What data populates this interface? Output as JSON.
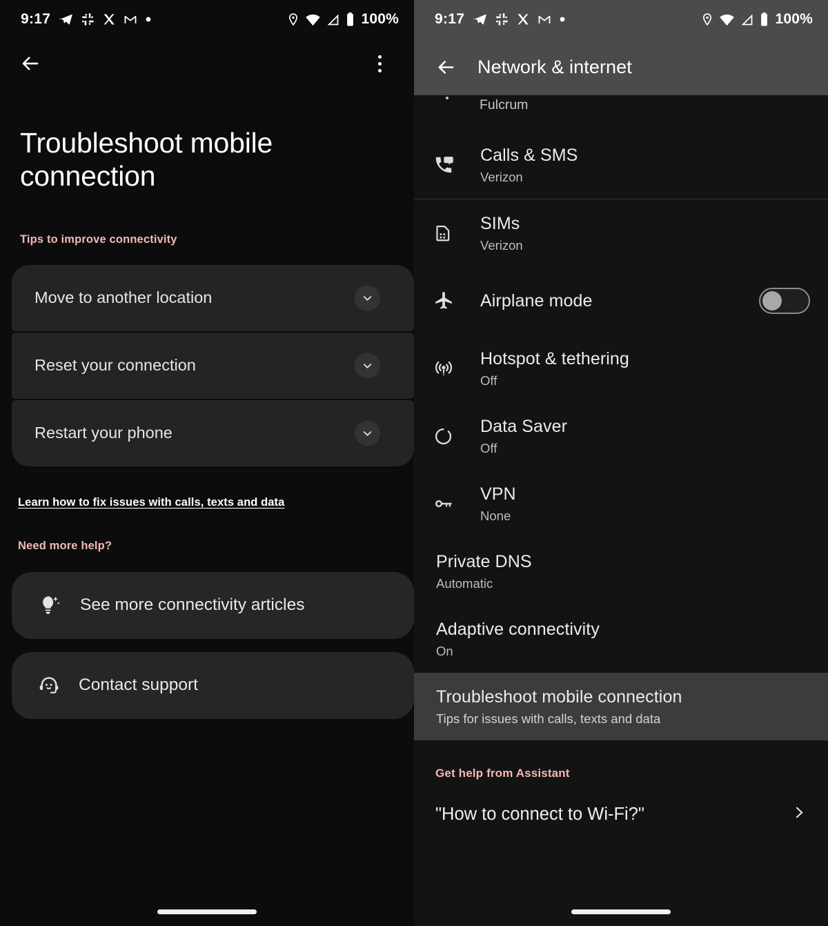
{
  "status_bar": {
    "time": "9:17",
    "battery_text": "100%",
    "notification_icons": [
      "telegram-icon",
      "slack-icon",
      "x-twitter-icon",
      "gmail-icon",
      "dot-icon"
    ],
    "system_icons": [
      "location-icon",
      "wifi-icon",
      "mobile-signal-icon",
      "battery-icon"
    ]
  },
  "left_panel": {
    "appbar": {
      "back_icon": "back-arrow-icon",
      "overflow_icon": "more-vert-icon"
    },
    "title": "Troubleshoot mobile connection",
    "tips_section_label": "Tips to improve connectivity",
    "expanders": [
      {
        "label": "Move to another location",
        "icon": "chevron-down-icon"
      },
      {
        "label": "Reset your connection",
        "icon": "chevron-down-icon"
      },
      {
        "label": "Restart your phone",
        "icon": "chevron-down-icon"
      }
    ],
    "learn_link": "Learn how to fix issues with calls, texts and data",
    "help_section_label": "Need more help?",
    "help_actions": [
      {
        "label": "See more connectivity articles",
        "icon": "lightbulb-sparkle-icon"
      },
      {
        "label": "Contact support",
        "icon": "support-agent-icon"
      }
    ]
  },
  "right_panel": {
    "appbar": {
      "back_icon": "back-arrow-icon",
      "title": "Network & internet"
    },
    "cut_off_row": {
      "subtitle": "Fulcrum"
    },
    "items": [
      {
        "label": "Calls & SMS",
        "sub": "Verizon",
        "icon": "phone-message-icon",
        "has_toggle": false
      },
      {
        "label": "SIMs",
        "sub": "Verizon",
        "icon": "sim-card-icon",
        "has_toggle": false
      },
      {
        "label": "Airplane mode",
        "sub": "",
        "icon": "airplane-icon",
        "has_toggle": true,
        "toggle_state": "off"
      },
      {
        "label": "Hotspot & tethering",
        "sub": "Off",
        "icon": "hotspot-icon",
        "has_toggle": false
      },
      {
        "label": "Data Saver",
        "sub": "Off",
        "icon": "data-saver-icon",
        "has_toggle": false
      },
      {
        "label": "VPN",
        "sub": "None",
        "icon": "vpn-key-icon",
        "has_toggle": false
      },
      {
        "label": "Private DNS",
        "sub": "Automatic",
        "icon": "",
        "has_toggle": false
      },
      {
        "label": "Adaptive connectivity",
        "sub": "On",
        "icon": "",
        "has_toggle": false
      },
      {
        "label": "Troubleshoot mobile connection",
        "sub": "Tips for issues with calls, texts and data",
        "icon": "",
        "has_toggle": false,
        "highlighted": true
      }
    ],
    "assistant_section_label": "Get help from Assistant",
    "assistant_query": "\"How to connect to Wi-Fi?\"",
    "assistant_chevron_icon": "chevron-right-icon"
  },
  "colors": {
    "accent_pink": "#f2b8b5",
    "left_bg": "#0c0c0c",
    "right_bg": "#131313",
    "header_gray": "#4b4b4b",
    "highlight_gray": "#3c3c3c",
    "card_gray": "#242424"
  }
}
